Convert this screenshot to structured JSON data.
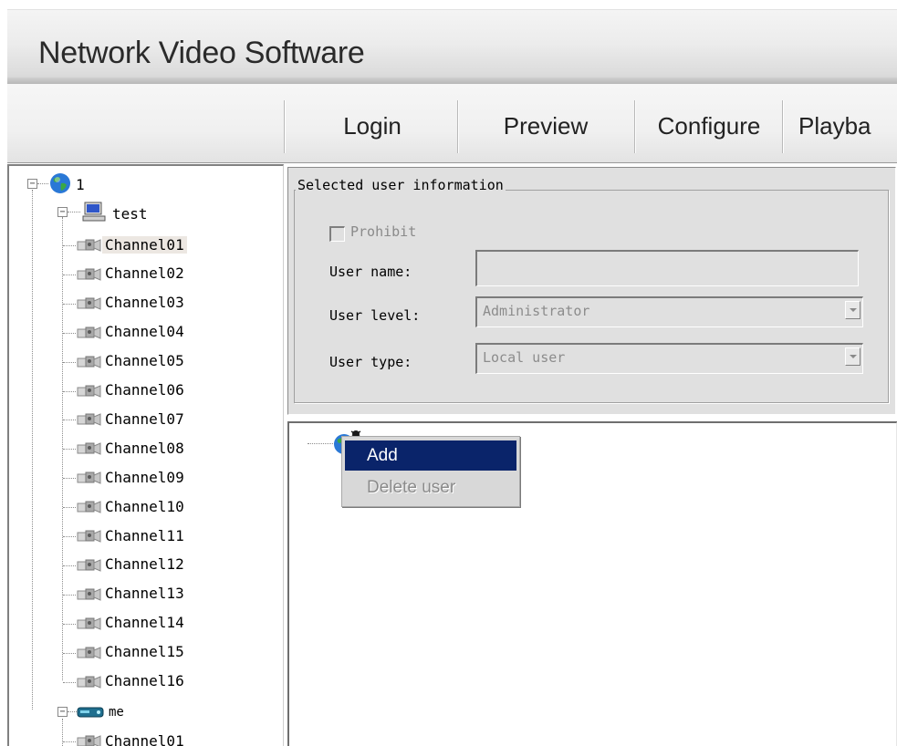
{
  "app": {
    "title": "Network Video Software"
  },
  "menu": {
    "tabs": [
      {
        "label": "Login"
      },
      {
        "label": "Preview"
      },
      {
        "label": "Configure"
      },
      {
        "label": "Playba"
      }
    ]
  },
  "tree": {
    "root_label": "1",
    "devices": [
      {
        "label": "test",
        "icon": "computer-icon",
        "channels": [
          "Channel01",
          "Channel02",
          "Channel03",
          "Channel04",
          "Channel05",
          "Channel06",
          "Channel07",
          "Channel08",
          "Channel09",
          "Channel10",
          "Channel11",
          "Channel12",
          "Channel13",
          "Channel14",
          "Channel15",
          "Channel16"
        ],
        "selected_channel": "Channel01"
      },
      {
        "label": "me",
        "icon": "dvr-device-icon",
        "channels": [
          "Channel01"
        ]
      }
    ]
  },
  "user_info": {
    "group_title": "Selected user information",
    "prohibit_label": "Prohibit",
    "prohibit_checked": false,
    "user_name_label": "User name:",
    "user_name_value": "",
    "user_level_label": "User level:",
    "user_level_value": "Administrator",
    "user_type_label": "User type:",
    "user_type_value": "Local user"
  },
  "context_menu": {
    "items": [
      {
        "label": "Add",
        "state": "highlighted"
      },
      {
        "label": "Delete user",
        "state": "disabled"
      }
    ]
  },
  "colors": {
    "selection_highlight": "#0a246a",
    "panel_bg": "#e0e0e0",
    "disabled_text": "#8a8a8a"
  }
}
